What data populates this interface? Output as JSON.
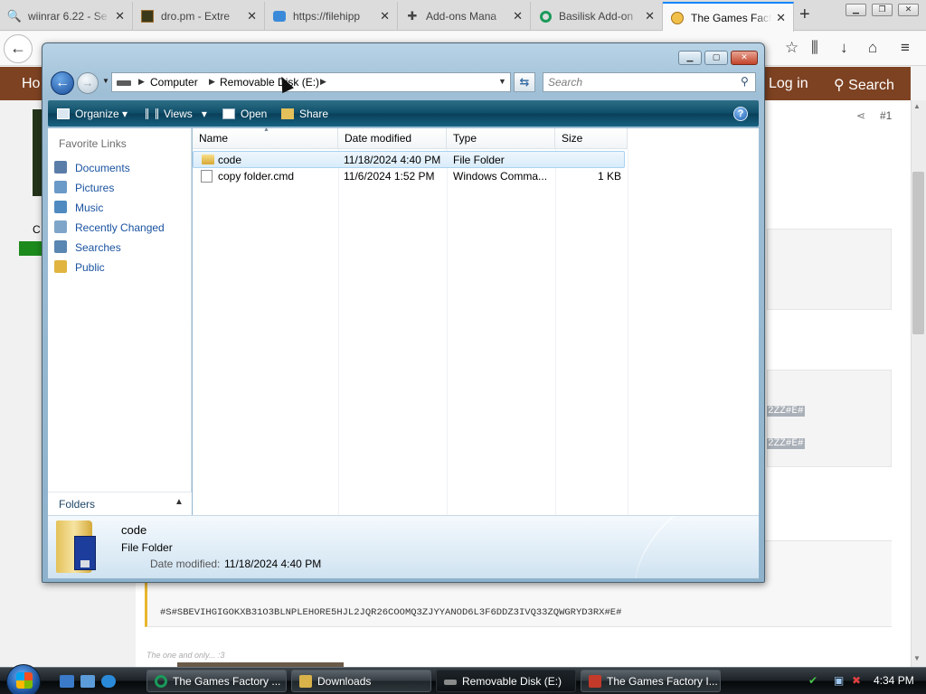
{
  "browser": {
    "tabs": [
      {
        "title": "wiinrar 6.22 - Se",
        "icon": "search-favicon",
        "color": "#1a6ed8"
      },
      {
        "title": "dro.pm - Extre",
        "icon": "dro-favicon",
        "color": "#3a3a1a"
      },
      {
        "title": "https://filehipp",
        "icon": "filehippo-favicon",
        "color": "#3b8ad9"
      },
      {
        "title": "Add-ons Mana",
        "icon": "puzzle-icon",
        "color": "#444444"
      },
      {
        "title": "Basilisk Add-on",
        "icon": "basilisk-favicon",
        "color": "#1a9a5a"
      },
      {
        "title": "The Games Fact",
        "icon": "clickteam-favicon",
        "color": "#d08a2a"
      }
    ],
    "new_tab": "+",
    "close_glyph": "✕"
  },
  "site": {
    "home_fragment": "Ho",
    "login": "Log in",
    "search": "Search",
    "user_fragment": "C",
    "post_number": "#1",
    "code_fragment_1": "2ZZ#E#",
    "code_fragment_2": "2ZZ#E#",
    "code_line": "#S#SBEVIHGIGOKXB31O3BLNPLEHORE5HJL2JQR26COOMQ3ZJYYANOD6L3F6DDZ3IVQ33ZQWGRYD3RX#E#",
    "footer_text": "The one and only... :3"
  },
  "explorer": {
    "breadcrumb": [
      "Computer",
      "Removable Disk (E:)"
    ],
    "search_placeholder": "Search",
    "commands": {
      "organize": "Organize",
      "views": "Views",
      "open": "Open",
      "share": "Share"
    },
    "favorite_links_title": "Favorite Links",
    "favorite_links": [
      {
        "label": "Documents",
        "icon": "documents-icon",
        "color": "#5a7da8"
      },
      {
        "label": "Pictures",
        "icon": "pictures-icon",
        "color": "#6a9ac8"
      },
      {
        "label": "Music",
        "icon": "music-icon",
        "color": "#4f8bc0"
      },
      {
        "label": "Recently Changed",
        "icon": "recent-icon",
        "color": "#7fa6c9"
      },
      {
        "label": "Searches",
        "icon": "searches-icon",
        "color": "#5a86b2"
      },
      {
        "label": "Public",
        "icon": "public-folder-icon",
        "color": "#e0b43f"
      }
    ],
    "folders_label": "Folders",
    "columns": [
      "Name",
      "Date modified",
      "Type",
      "Size"
    ],
    "files": [
      {
        "name": "code",
        "date": "11/18/2024 4:40 PM",
        "type": "File Folder",
        "size": "",
        "icon": "folder-icon",
        "selected": true
      },
      {
        "name": "copy folder.cmd",
        "date": "11/6/2024 1:52 PM",
        "type": "Windows Comma...",
        "size": "1 KB",
        "icon": "cmd-file-icon",
        "selected": false
      }
    ],
    "details": {
      "name": "code",
      "type": "File Folder",
      "date_label": "Date modified:",
      "date_value": "11/18/2024 4:40 PM"
    }
  },
  "taskbar": {
    "buttons": [
      {
        "label": "The Games Factory ...",
        "icon": "basilisk-taskbar-icon",
        "color": "#1a9a5a"
      },
      {
        "label": "Downloads",
        "icon": "folder-taskbar-icon",
        "color": "#d9b24a"
      },
      {
        "label": "Removable Disk (E:)",
        "icon": "drive-taskbar-icon",
        "color": "#8a8a8a"
      },
      {
        "label": "The Games Factory I...",
        "icon": "tgf-taskbar-icon",
        "color": "#c43a2a"
      }
    ],
    "clock": "4:34 PM"
  }
}
